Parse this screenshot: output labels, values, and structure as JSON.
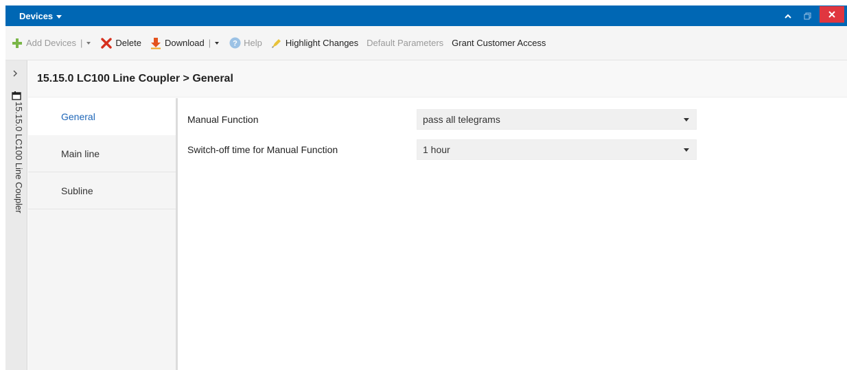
{
  "window": {
    "title": "Devices"
  },
  "toolbar": {
    "add_devices": "Add Devices",
    "delete": "Delete",
    "download": "Download",
    "help": "Help",
    "highlight_changes": "Highlight Changes",
    "default_parameters": "Default Parameters",
    "grant_customer_access": "Grant Customer Access",
    "separator": "|"
  },
  "sidepanel": {
    "label": "15.15.0 LC100 Line Coupler"
  },
  "header": {
    "title": "15.15.0 LC100 Line Coupler > General"
  },
  "tabs": [
    {
      "label": "General",
      "active": true
    },
    {
      "label": "Main line",
      "active": false
    },
    {
      "label": "Subline",
      "active": false
    }
  ],
  "params": [
    {
      "label": "Manual Function",
      "value": "pass all telegrams"
    },
    {
      "label": "Switch-off time for Manual Function",
      "value": "1 hour"
    }
  ],
  "colors": {
    "titlebar": "#0067b4",
    "close": "#e0363f",
    "active_tab_text": "#1e66b8",
    "add_icon": "#7ab648",
    "delete_icon": "#d6301e",
    "download_icon": "#e4531d",
    "help_icon": "#9cc2e5",
    "highlight_icon": "#e8c23a"
  },
  "icons": {
    "add": "plus-icon",
    "delete": "x-icon",
    "download": "download-arrow-icon",
    "help": "help-icon",
    "highlight": "marker-icon"
  }
}
